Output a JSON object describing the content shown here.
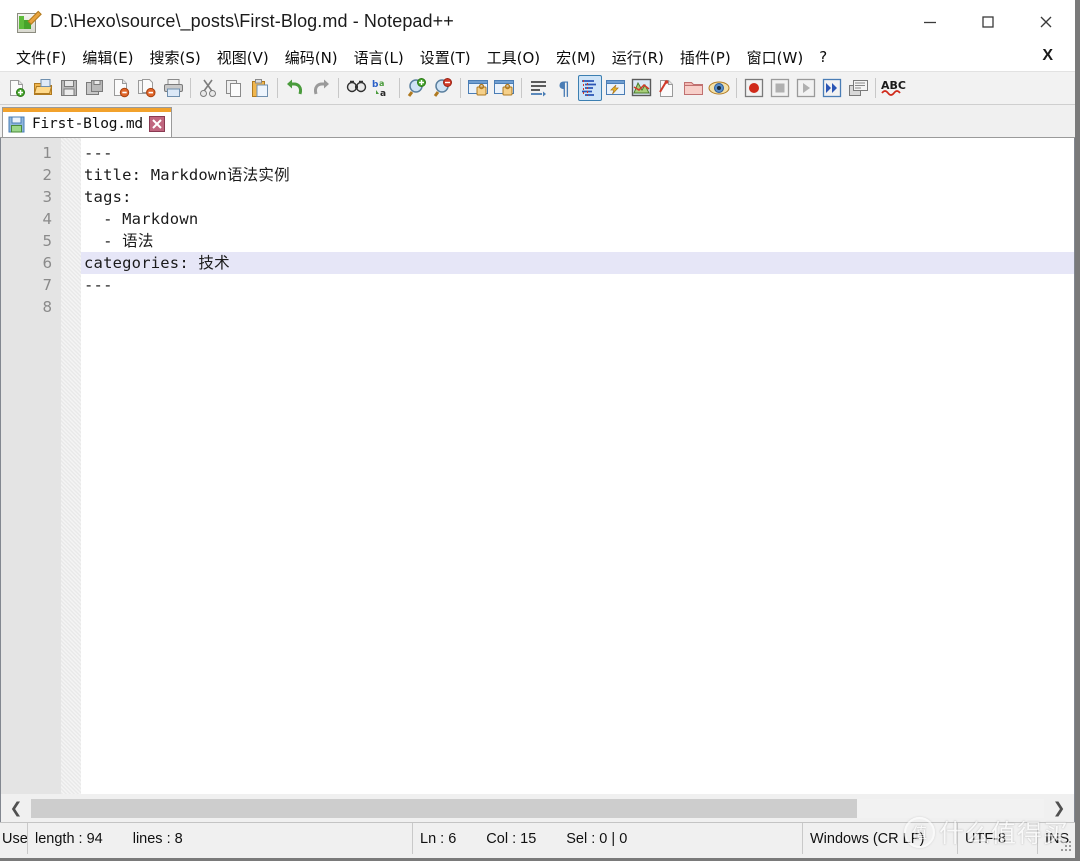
{
  "window": {
    "title": "D:\\Hexo\\source\\_posts\\First-Blog.md - Notepad++",
    "icon": "notepad-plus-plus-icon",
    "controls": {
      "minimize": "—",
      "maximize": "□",
      "close": "✕"
    }
  },
  "menu": {
    "items": [
      {
        "label": "文件(F)",
        "name": "menu-file"
      },
      {
        "label": "编辑(E)",
        "name": "menu-edit"
      },
      {
        "label": "搜索(S)",
        "name": "menu-search"
      },
      {
        "label": "视图(V)",
        "name": "menu-view"
      },
      {
        "label": "编码(N)",
        "name": "menu-encoding"
      },
      {
        "label": "语言(L)",
        "name": "menu-language"
      },
      {
        "label": "设置(T)",
        "name": "menu-settings"
      },
      {
        "label": "工具(O)",
        "name": "menu-tools"
      },
      {
        "label": "宏(M)",
        "name": "menu-macro"
      },
      {
        "label": "运行(R)",
        "name": "menu-run"
      },
      {
        "label": "插件(P)",
        "name": "menu-plugins"
      },
      {
        "label": "窗口(W)",
        "name": "menu-window"
      },
      {
        "label": "?",
        "name": "menu-help"
      }
    ],
    "close_doc": "X"
  },
  "toolbar": {
    "buttons": [
      "new-file-icon",
      "open-file-icon",
      "save-icon",
      "save-all-icon",
      "close-file-icon",
      "close-all-icon",
      "print-icon",
      "SEP",
      "cut-icon",
      "copy-icon",
      "paste-icon",
      "SEP",
      "undo-icon",
      "redo-icon",
      "SEP",
      "find-icon",
      "replace-icon",
      "SEP",
      "zoom-in-icon",
      "zoom-out-icon",
      "SEP",
      "sync-vertical-scroll-icon",
      "sync-horizontal-scroll-icon",
      "SEP",
      "word-wrap-icon",
      "show-all-characters-icon",
      "indent-guideline-icon",
      "user-defined-dialog-icon",
      "document-map-icon",
      "function-list-icon",
      "folder-as-workspace-icon",
      "monitoring-icon",
      "SEP",
      "start-record-macro-icon",
      "stop-record-macro-icon",
      "play-macro-icon",
      "run-macro-multiple-icon",
      "save-macro-icon",
      "SEP",
      "spell-check-icon"
    ],
    "selected": "indent-guideline-icon"
  },
  "tabs": [
    {
      "label": "First-Blog.md",
      "icon": "saved-document-icon",
      "close": "close-tab-icon",
      "active": true
    }
  ],
  "editor": {
    "lines": [
      {
        "num": "1",
        "text": "---",
        "current": false
      },
      {
        "num": "2",
        "text": "title: Markdown语法实例",
        "current": false
      },
      {
        "num": "3",
        "text": "tags:",
        "current": false
      },
      {
        "num": "4",
        "text": "  - Markdown",
        "current": false
      },
      {
        "num": "5",
        "text": "  - 语法",
        "current": false
      },
      {
        "num": "6",
        "text": "categories: 技术",
        "current": true
      },
      {
        "num": "7",
        "text": "---",
        "current": false
      },
      {
        "num": "8",
        "text": "",
        "current": false
      }
    ]
  },
  "scrollbar": {
    "left_arrow": "❮",
    "right_arrow": "❯"
  },
  "statusbar": {
    "user_define": "Use",
    "length_label": "length : 94",
    "lines_label": "lines : 8",
    "ln": "Ln : 6",
    "col": "Col : 15",
    "sel": "Sel : 0 | 0",
    "eol": "Windows (CR LF)",
    "encoding": "UTF-8",
    "insert_mode": "INS"
  },
  "watermark": {
    "badge": "值",
    "text": "什么值得买"
  },
  "colors": {
    "accent_tab": "#f2a22c",
    "current_line": "#e6e6f7",
    "gutter": "#e4e4e4",
    "toolbar_selected_border": "#3c7fb1",
    "markdown_bullet": "#3a56c8"
  }
}
